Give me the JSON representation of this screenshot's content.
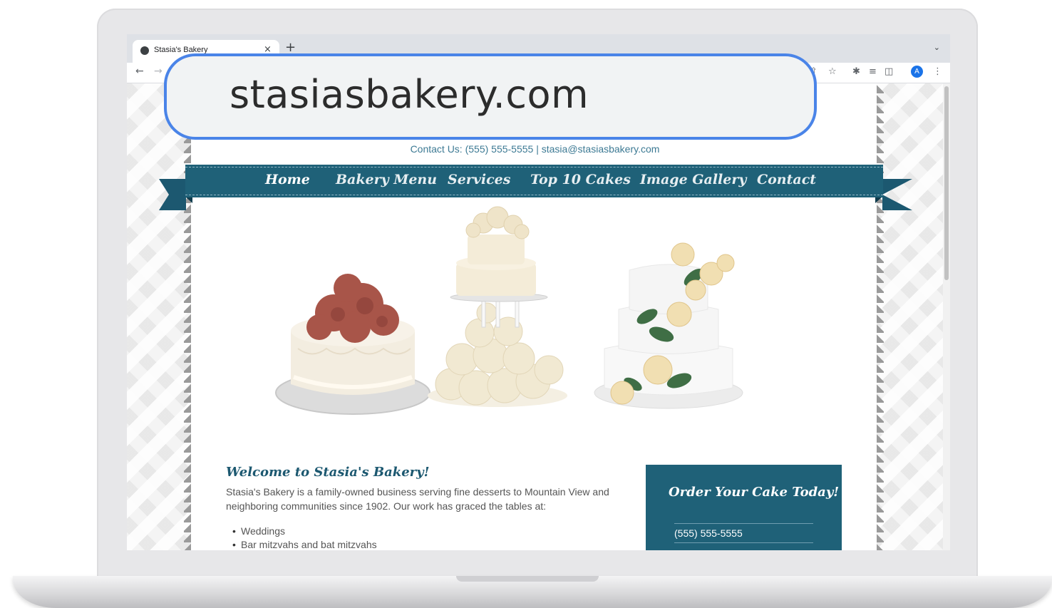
{
  "browser": {
    "tab_title": "Stasia's Bakery",
    "tab_close": "×",
    "new_tab": "+",
    "avatar_letter": "A",
    "url": "stasiasbakery.com"
  },
  "site": {
    "contact_line": "Contact Us:  (555) 555-5555  |   stasia@stasiasbakery.com",
    "nav": [
      {
        "label": "Home"
      },
      {
        "label": "Bakery Menu"
      },
      {
        "label": "Services"
      },
      {
        "label": "Top 10 Cakes"
      },
      {
        "label": "Image Gallery"
      },
      {
        "label": "Contact"
      }
    ],
    "welcome_title": "Welcome to Stasia's Bakery!",
    "welcome_text": "Stasia's Bakery is a family-owned business serving fine desserts to Mountain View and neighboring communities since 1902. Our work has graced the tables at:",
    "bullets": [
      "Weddings",
      "Bar mitzvahs and bat mitzvahs"
    ],
    "order_title": "Order Your Cake Today!",
    "order_phone": "(555) 555-5555"
  },
  "colors": {
    "brand_teal": "#1f6178",
    "callout_border": "#4a84e8"
  }
}
